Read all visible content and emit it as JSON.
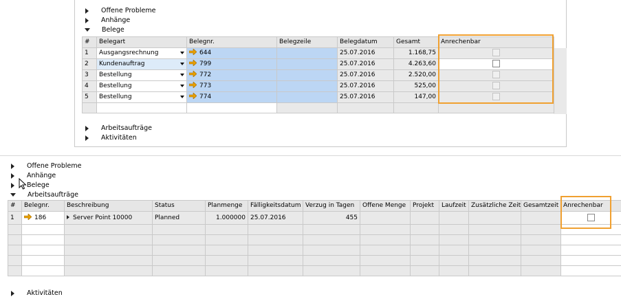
{
  "top": {
    "sections": {
      "offene_probleme": "Offene Probleme",
      "anhaenge": "Anhänge",
      "belege": "Belege",
      "arbeitsauftraege": "Arbeitsaufträge",
      "aktivitaeten": "Aktivitäten"
    },
    "columns": [
      "#",
      "Belegart",
      "Belegnr.",
      "Belegzeile",
      "Belegdatum",
      "Gesamt",
      "Anrechenbar"
    ],
    "rows": [
      {
        "num": "1",
        "belegart": "Ausgangsrechnung",
        "belegnr": "644",
        "belegzeile": "",
        "datum": "25.07.2016",
        "gesamt": "1.168,75"
      },
      {
        "num": "2",
        "belegart": "Kundenauftrag",
        "belegnr": "799",
        "belegzeile": "",
        "datum": "25.07.2016",
        "gesamt": "4.263,60"
      },
      {
        "num": "3",
        "belegart": "Bestellung",
        "belegnr": "772",
        "belegzeile": "",
        "datum": "25.07.2016",
        "gesamt": "2.520,00"
      },
      {
        "num": "4",
        "belegart": "Bestellung",
        "belegnr": "773",
        "belegzeile": "",
        "datum": "25.07.2016",
        "gesamt": "525,00"
      },
      {
        "num": "5",
        "belegart": "Bestellung",
        "belegnr": "774",
        "belegzeile": "",
        "datum": "25.07.2016",
        "gesamt": "147,00"
      }
    ]
  },
  "bottom": {
    "sections": {
      "offene_probleme": "Offene Probleme",
      "anhaenge": "Anhänge",
      "belege": "Belege",
      "arbeitsauftraege": "Arbeitsaufträge",
      "aktivitaeten": "Aktivitäten"
    },
    "columns": [
      "#",
      "Belegnr.",
      "Beschreibung",
      "Status",
      "Planmenge",
      "Fälligkeitsdatum",
      "Verzug in Tagen",
      "Offene Menge",
      "Projekt",
      "Laufzeit",
      "Zusätzliche Zeit",
      "Gesamtzeit",
      "Anrechenbar"
    ],
    "row": {
      "num": "1",
      "belegnr": "186",
      "beschreibung": "Server Point 10000",
      "status": "Planned",
      "planmenge": "1.000000",
      "faelligkeit": "25.07.2016",
      "verzug": "455"
    }
  },
  "colors": {
    "highlight": "#f0a030",
    "link_arrow": "#e8a000",
    "selection_blue": "#bcd6f4"
  },
  "icons": {
    "link": "link-arrow-icon",
    "expand": "triangle-right-icon",
    "collapse": "triangle-down-icon",
    "cursor": "mouse-cursor-icon"
  }
}
